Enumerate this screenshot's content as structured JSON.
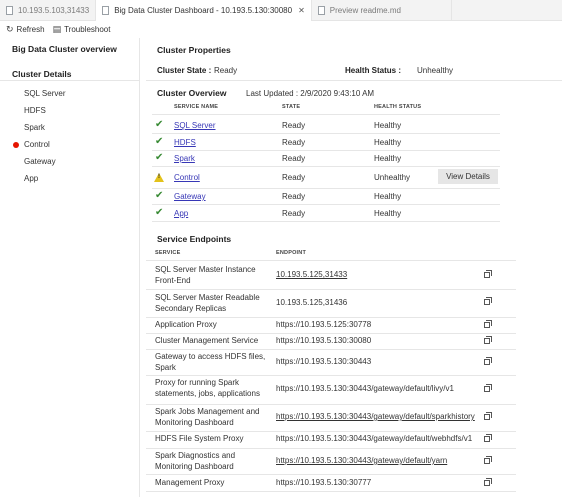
{
  "tabs": [
    {
      "label": "10.193.5.103,31433"
    },
    {
      "label": "Big Data Cluster Dashboard - 10.193.5.130:30080"
    },
    {
      "label": "Preview readme.md"
    }
  ],
  "toolbar": {
    "refresh": "Refresh",
    "troubleshoot": "Troubleshoot"
  },
  "sidebar": {
    "title": "Big Data Cluster overview",
    "section": "Cluster Details",
    "items": [
      "SQL Server",
      "HDFS",
      "Spark",
      "Control",
      "Gateway",
      "App"
    ]
  },
  "properties": {
    "title": "Cluster Properties",
    "state_label": "Cluster State :",
    "state_value": "Ready",
    "health_label": "Health Status :",
    "health_value": "Unhealthy"
  },
  "overview": {
    "title": "Cluster Overview",
    "updated": "Last Updated : 2/9/2020 9:43:10 AM",
    "headers": [
      "SERVICE NAME",
      "STATE",
      "HEALTH STATUS"
    ],
    "rows": [
      {
        "name": "SQL Server",
        "state": "Ready",
        "health": "Healthy",
        "icon": "check-icon"
      },
      {
        "name": "HDFS",
        "state": "Ready",
        "health": "Healthy",
        "icon": "check-icon"
      },
      {
        "name": "Spark",
        "state": "Ready",
        "health": "Healthy",
        "icon": "check-icon"
      },
      {
        "name": "Control",
        "state": "Ready",
        "health": "Unhealthy",
        "icon": "warning-icon"
      },
      {
        "name": "Gateway",
        "state": "Ready",
        "health": "Healthy",
        "icon": "check-icon"
      },
      {
        "name": "App",
        "state": "Ready",
        "health": "Healthy",
        "icon": "check-icon"
      }
    ],
    "view_details": "View Details"
  },
  "endpoints": {
    "title": "Service Endpoints",
    "headers": [
      "SERVICE",
      "ENDPOINT"
    ],
    "rows": [
      {
        "service": "SQL Server Master Instance Front-End",
        "endpoint": "10.193.5.125,31433",
        "link": true
      },
      {
        "service": "SQL Server Master Readable Secondary Replicas",
        "endpoint": "10.193.5.125,31436",
        "link": false
      },
      {
        "service": "Application Proxy",
        "endpoint": "https://10.193.5.125:30778",
        "link": false
      },
      {
        "service": "Cluster Management Service",
        "endpoint": "https://10.193.5.130:30080",
        "link": false
      },
      {
        "service": "Gateway to access HDFS files, Spark",
        "endpoint": "https://10.193.5.130:30443",
        "link": false
      },
      {
        "service": "Proxy for running Spark statements, jobs, applications",
        "endpoint": "https://10.193.5.130:30443/gateway/default/livy/v1",
        "link": false
      },
      {
        "service": "Spark Jobs Management and Monitoring Dashboard",
        "endpoint": "https://10.193.5.130:30443/gateway/default/sparkhistory",
        "link": true
      },
      {
        "service": "HDFS File System Proxy",
        "endpoint": "https://10.193.5.130:30443/gateway/default/webhdfs/v1",
        "link": false
      },
      {
        "service": "Spark Diagnostics and Monitoring Dashboard",
        "endpoint": "https://10.193.5.130:30443/gateway/default/yarn",
        "link": true
      },
      {
        "service": "Management Proxy",
        "endpoint": "https://10.193.5.130:30777",
        "link": false
      }
    ]
  },
  "colors": {
    "link": "#3737b6",
    "healthy": "#388a34",
    "warning": "#e3c21b",
    "error": "#e51400"
  }
}
